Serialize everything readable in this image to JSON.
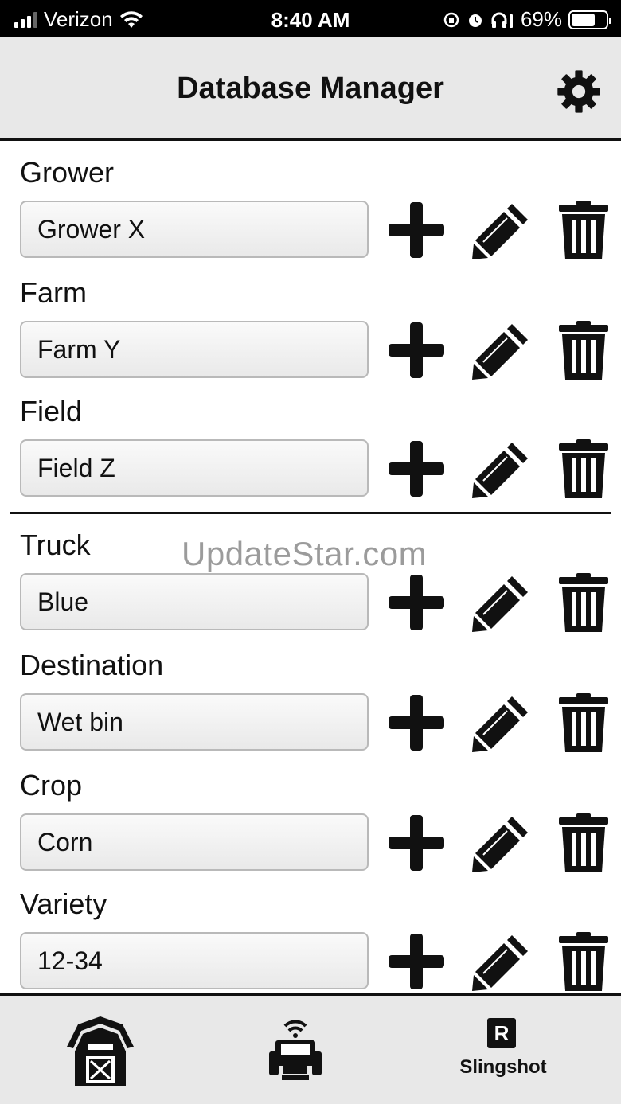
{
  "status_bar": {
    "carrier": "Verizon",
    "time": "8:40 AM",
    "battery_percent": "69%",
    "battery_level": 0.69
  },
  "header": {
    "title": "Database Manager"
  },
  "groups": [
    {
      "rows": [
        {
          "label": "Grower",
          "value": "Grower X"
        },
        {
          "label": "Farm",
          "value": "Farm Y"
        },
        {
          "label": "Field",
          "value": "Field Z"
        }
      ]
    },
    {
      "rows": [
        {
          "label": "Truck",
          "value": "Blue"
        },
        {
          "label": "Destination",
          "value": "Wet bin"
        },
        {
          "label": "Crop",
          "value": "Corn"
        },
        {
          "label": "Variety",
          "value": "12-34"
        }
      ]
    }
  ],
  "watermark": "UpdateStar.com",
  "tab_bar": {
    "tabs": [
      {
        "icon": "barn-icon"
      },
      {
        "icon": "tractor-wireless-icon"
      },
      {
        "icon": "slingshot-logo-icon",
        "logo_letter": "R",
        "label": "Slingshot"
      }
    ]
  },
  "colors": {
    "header_bg": "#e8e8e8",
    "icon": "#111111",
    "status_bar_bg": "#000000"
  }
}
